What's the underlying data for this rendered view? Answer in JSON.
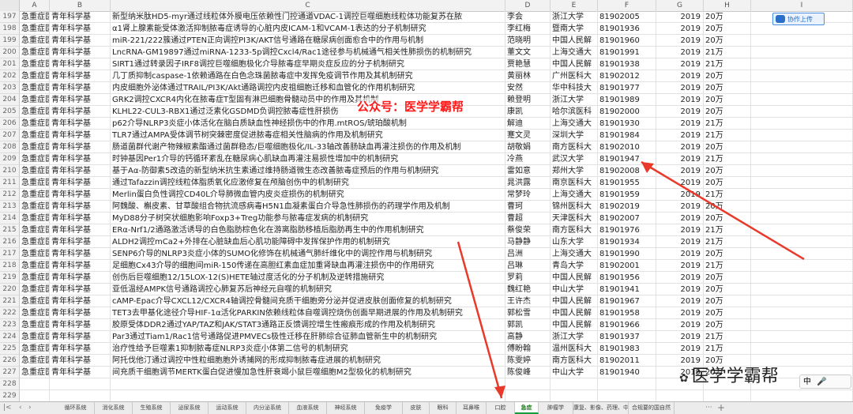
{
  "columns": [
    "A",
    "B",
    "C",
    "D",
    "E",
    "F",
    "G",
    "H",
    "I"
  ],
  "rows": [
    {
      "n": "197",
      "a": "急重症医学",
      "b": "青年科学基",
      "c": "新型纳米肽HD5-myr通过线粒体外膜电压依赖性门控通道VDAC-1调控巨噬细胞线粒体功能复苏在脓",
      "d": "李会",
      "e": "浙江大学",
      "f": "81902005",
      "g": "2019",
      "h": "20万"
    },
    {
      "n": "198",
      "a": "急重症医学",
      "b": "青年科学基",
      "c": "α1肾上腺素能受体激活抑制脓毒症诱导的心脏内皮ICAM-1和VCAM-1表达的分子机制研究",
      "d": "李红梅",
      "e": "暨南大学",
      "f": "81901936",
      "g": "2019",
      "h": "20万"
    },
    {
      "n": "199",
      "a": "急重症医学",
      "b": "青年科学基",
      "c": "miR-221/222簇通过PTEN正向调控PI3K/AKT信号通路在糖尿病创面愈合中的作用与机制",
      "d": "范晓明",
      "e": "中国人民解",
      "f": "81901960",
      "g": "2019",
      "h": "20万"
    },
    {
      "n": "200",
      "a": "急重症医学",
      "b": "青年科学基",
      "c": "LncRNA-GM19897通过miRNA-1233-5p调控Cxcl4/Rac1途径参与机械通气相关性肺损伤的机制研究",
      "d": "董文文",
      "e": "上海交通大",
      "f": "81901991",
      "g": "2019",
      "h": "21万"
    },
    {
      "n": "201",
      "a": "急重症医学",
      "b": "青年科学基",
      "c": "SIRT1通过转录因子IRF8调控巨噬细胞极化介导脓毒症早期炎症反应的分子机制研究",
      "d": "贾艳慧",
      "e": "中国人民解",
      "f": "81901938",
      "g": "2019",
      "h": "21万"
    },
    {
      "n": "202",
      "a": "急重症医学",
      "b": "青年科学基",
      "c": "几丁质抑制caspase-1依赖通路在白色念珠菌脓毒症中发挥免疫调节作用及其机制研究",
      "d": "黄丽林",
      "e": "广州医科大",
      "f": "81902012",
      "g": "2019",
      "h": "20万"
    },
    {
      "n": "203",
      "a": "急重症医学",
      "b": "青年科学基",
      "c": "内皮细胞外泌体通过TRAIL/PI3K/Akt通路调控内皮祖细胞迁移和血管化的作用机制研究",
      "d": "安然",
      "e": "华中科技大",
      "f": "81901977",
      "g": "2019",
      "h": "20万"
    },
    {
      "n": "204",
      "a": "急重症医学",
      "b": "青年科学基",
      "c": "GRK2调控CXCR4内化在脓毒症T型固有淋巴细胞骨髓动员中的作用及其机制",
      "d": "赖登明",
      "e": "浙江大学",
      "f": "81901989",
      "g": "2019",
      "h": "20万"
    },
    {
      "n": "205",
      "a": "急重症医学",
      "b": "青年科学基",
      "c": "KLHL22-CUL3-RBX1通过泛素化GSDMD负调控脓毒症性肝损伤",
      "d": "康凯",
      "e": "哈尔滨医科",
      "f": "81902000",
      "g": "2019",
      "h": "20万"
    },
    {
      "n": "206",
      "a": "急重症医学",
      "b": "青年科学基",
      "c": "p62介导NLRP3炎症小体活化在脑白质缺血性神经损伤中的作用.mtROS/琥珀酸机制",
      "d": "解迪",
      "e": "上海交通大",
      "f": "81901930",
      "g": "2019",
      "h": "21万"
    },
    {
      "n": "207",
      "a": "急重症医学",
      "b": "青年科学基",
      "c": "TLR7通过AMPA受体调节树突棘密度促进脓毒症相关性脑病的作用及机制研究",
      "d": "蹇文灵",
      "e": "深圳大学",
      "f": "81901984",
      "g": "2019",
      "h": "21万"
    },
    {
      "n": "208",
      "a": "急重症医学",
      "b": "青年科学基",
      "c": "肠道菌群代谢产物辣椒素酯通过菌群稳态/巨噬细胞极化/IL-33轴改善肠缺血再灌注损伤的作用及机制",
      "d": "胡敬娟",
      "e": "南方医科大",
      "f": "81902010",
      "g": "2019",
      "h": "20万"
    },
    {
      "n": "209",
      "a": "急重症医学",
      "b": "青年科学基",
      "c": "时钟基因Per1介导的钙循环紊乱在糖尿病心肌缺血再灌注易损性增加中的机制研究",
      "d": "冷燕",
      "e": "武汉大学",
      "f": "81901947",
      "g": "2019",
      "h": "21万"
    },
    {
      "n": "210",
      "a": "急重症医学",
      "b": "青年科学基",
      "c": "基于Aα-防御素5改造的新型纳米抗生素通过维持肠道微生态改善脓毒症预后的作用与机制研究",
      "d": "雷如意",
      "e": "郑州大学",
      "f": "81902008",
      "g": "2019",
      "h": "20万"
    },
    {
      "n": "211",
      "a": "急重症医学",
      "b": "青年科学基",
      "c": "通过Tafazzin调控线粒体脂质氧化应激修复在颅脑创伤中的机制研究",
      "d": "晁洪露",
      "e": "南京医科大",
      "f": "81901955",
      "g": "2019",
      "h": "20万"
    },
    {
      "n": "212",
      "a": "急重症医学",
      "b": "青年科学基",
      "c": "Merlin蛋白负性调控CD40L介导肺微血管内皮炎症损伤的机制研究",
      "d": "常梦玲",
      "e": "上海交通大",
      "f": "81901959",
      "g": "2019",
      "h": "21万"
    },
    {
      "n": "213",
      "a": "急重症医学",
      "b": "青年科学基",
      "c": "阿魏酸、槲皮素、甘草酸组合物抗流感病毒H5N1血凝素蛋白介导急性肺损伤的药理学作用及机制",
      "d": "曹珂",
      "e": "锦州医科大",
      "f": "81902019",
      "g": "2019",
      "h": "20万"
    },
    {
      "n": "214",
      "a": "急重症医学",
      "b": "青年科学基",
      "c": "MyD88分子树突状细胞影响Foxp3+Treg功能参与脓毒症发病的机制研究",
      "d": "曹超",
      "e": "天津医科大",
      "f": "81902007",
      "g": "2019",
      "h": "20万"
    },
    {
      "n": "215",
      "a": "急重症医学",
      "b": "青年科学基",
      "c": "ERα-Nrf1/2通路激活诱导的白色脂肪棕色化在游离脂肪移植后脂肪再生中的作用机制研究",
      "d": "蔡俊荣",
      "e": "南方医科大",
      "f": "81901976",
      "g": "2019",
      "h": "21万"
    },
    {
      "n": "216",
      "a": "急重症医学",
      "b": "青年科学基",
      "c": "ALDH2调控mCa2+外排在心脏缺血后心肌功能障碍中发挥保护作用的机制研究",
      "d": "马静静",
      "e": "山东大学",
      "f": "81901934",
      "g": "2019",
      "h": "21万"
    },
    {
      "n": "217",
      "a": "急重症医学",
      "b": "青年科学基",
      "c": "SENP6介导的NLRP3炎症小体的SUMO化修饰在机械通气肺纤维化中的调控作用与机制研究",
      "d": "吕洲",
      "e": "上海交通大",
      "f": "81901990",
      "g": "2019",
      "h": "20万"
    },
    {
      "n": "218",
      "a": "急重症医学",
      "b": "青年科学基",
      "c": "足细胞Cx43介导的细胞间miR-150传递在高胆红素血症加重肾缺血再灌注损伤中的作用研究",
      "d": "吕琳",
      "e": "青岛大学",
      "f": "81902001",
      "g": "2019",
      "h": "21万"
    },
    {
      "n": "219",
      "a": "急重症医学",
      "b": "青年科学基",
      "c": "创伤后巨噬细胞12/15LOX-12(S)HETE轴过度活化的分子机制及逆转措施研究",
      "d": "罗莉",
      "e": "中国人民解",
      "f": "81901956",
      "g": "2019",
      "h": "20万"
    },
    {
      "n": "220",
      "a": "急重症医学",
      "b": "青年科学基",
      "c": "亚低温经AMPK信号通路调控心肺复苏后神经元自噬的机制研究",
      "d": "魏红艳",
      "e": "中山大学",
      "f": "81901941",
      "g": "2019",
      "h": "20万"
    },
    {
      "n": "221",
      "a": "急重症医学",
      "b": "青年科学基",
      "c": "cAMP-Epac介导CXCL12/CXCR4轴调控骨髓间充质干细胞旁分泌并促进皮肤创面修复的机制研究",
      "d": "王许杰",
      "e": "中国人民解",
      "f": "81901967",
      "g": "2019",
      "h": "20万"
    },
    {
      "n": "222",
      "a": "急重症医学",
      "b": "青年科学基",
      "c": "TET3去甲基化途径介导HIF-1α活化PARKIN依赖线粒体自噬调控烧伤创面早期进展的作用及机制研究",
      "d": "郭松雪",
      "e": "中国人民解",
      "f": "81901958",
      "g": "2019",
      "h": "20万"
    },
    {
      "n": "223",
      "a": "急重症医学",
      "b": "青年科学基",
      "c": "胶原受体DDR2通过YAP/TAZ和JAK/STAT3通路正反馈调控增生性瘢痕形成的作用及机制研究",
      "d": "郭凯",
      "e": "中国人民解",
      "f": "81901966",
      "g": "2019",
      "h": "20万"
    },
    {
      "n": "224",
      "a": "急重症医学",
      "b": "青年科学基",
      "c": "Par3通过Tiam1/Rac1信号通路促进PMVECs极性迁移在肝肺综合征肺血管新生中的机制研究",
      "d": "高静",
      "e": "浙江大学",
      "f": "81901937",
      "g": "2019",
      "h": "21万"
    },
    {
      "n": "225",
      "a": "急重症医学",
      "b": "青年科学基",
      "c": "治疗性给予巨噬素1抑制脓毒症NLRP3炎症小体第二信号的机制研究",
      "d": "傅盼翰",
      "e": "温州医科大",
      "f": "81901983",
      "g": "2019",
      "h": "21万"
    },
    {
      "n": "226",
      "a": "急重症医学",
      "b": "青年科学基",
      "c": "阿托伐他汀通过调控中性粒细胞胞外诱捕网的形成抑制脓毒症进展的机制研究",
      "d": "陈雯婷",
      "e": "南方医科大",
      "f": "81902011",
      "g": "2019",
      "h": "20万"
    },
    {
      "n": "227",
      "a": "急重症医学",
      "b": "青年科学基",
      "c": "间充质干细胞调节MERTK蛋白促进慢加急性肝衰竭小鼠巨噬细胞M2型极化的机制研究",
      "d": "陈俊峰",
      "e": "中山大学",
      "f": "81901940",
      "g": "2019",
      "h": "20万"
    },
    {
      "n": "228",
      "a": "",
      "b": "",
      "c": "",
      "d": "",
      "e": "",
      "f": "",
      "g": "",
      "h": ""
    },
    {
      "n": "229",
      "a": "",
      "b": "",
      "c": "",
      "d": "",
      "e": "",
      "f": "",
      "g": "",
      "h": ""
    },
    {
      "n": "230",
      "a": "",
      "b": "",
      "c": "",
      "d": "",
      "e": "",
      "f": "",
      "g": "",
      "h": ""
    }
  ],
  "watermark_top": "公众号：医学学霸帮",
  "share_button": "协作上传",
  "brand_text": "医学学霸帮",
  "system_tray": "中",
  "sheet_tabs": [
    "循环系统",
    "消化系统",
    "生殖系统",
    "泌尿系统",
    "运动系统",
    "内分泌系统",
    "血液系统",
    "神经系统",
    "免疫学",
    "皮肤",
    "眼科",
    "耳鼻喉",
    "口腔",
    "急症",
    "肿瘤学",
    "康复、影像、药理、中医",
    "合规要的国自然"
  ],
  "active_tab_index": 13,
  "nav_left_label": "|<",
  "nav_add_label": "+",
  "nav_more_label": "···",
  "colors": {
    "active_tab": "#1a9b3a",
    "watermark": "#ff1a1a",
    "arrow": "#e8392b"
  }
}
